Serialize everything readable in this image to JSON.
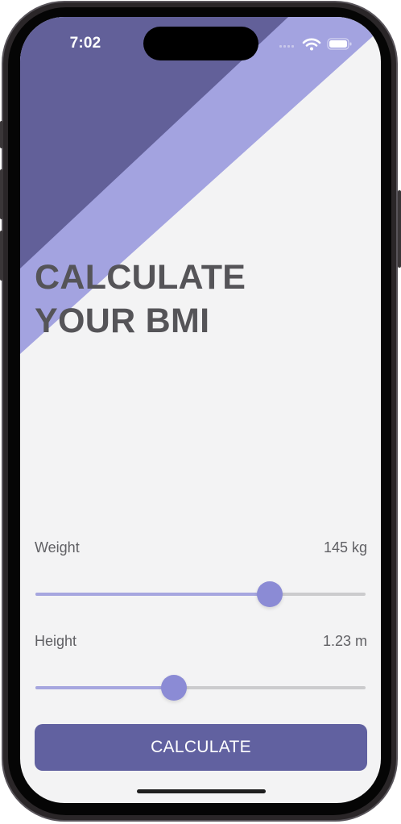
{
  "status_bar": {
    "time": "7:02",
    "icons": [
      "signal-icon",
      "wifi-icon",
      "battery-icon"
    ]
  },
  "header": {
    "title_line1": "CALCULATE",
    "title_line2": "YOUR BMI"
  },
  "weight": {
    "label": "Weight",
    "value": "145 kg",
    "slider_level": 0.71
  },
  "height": {
    "label": "Height",
    "value": "1.23 m",
    "slider_level": 0.42
  },
  "calculate_button": {
    "label": "CALCULATE"
  },
  "colors": {
    "primary": "#6161a0",
    "accent_light": "#a3a3e0",
    "slider_thumb": "#8b8bd5",
    "background": "#f3f3f4",
    "text": "#555458"
  }
}
